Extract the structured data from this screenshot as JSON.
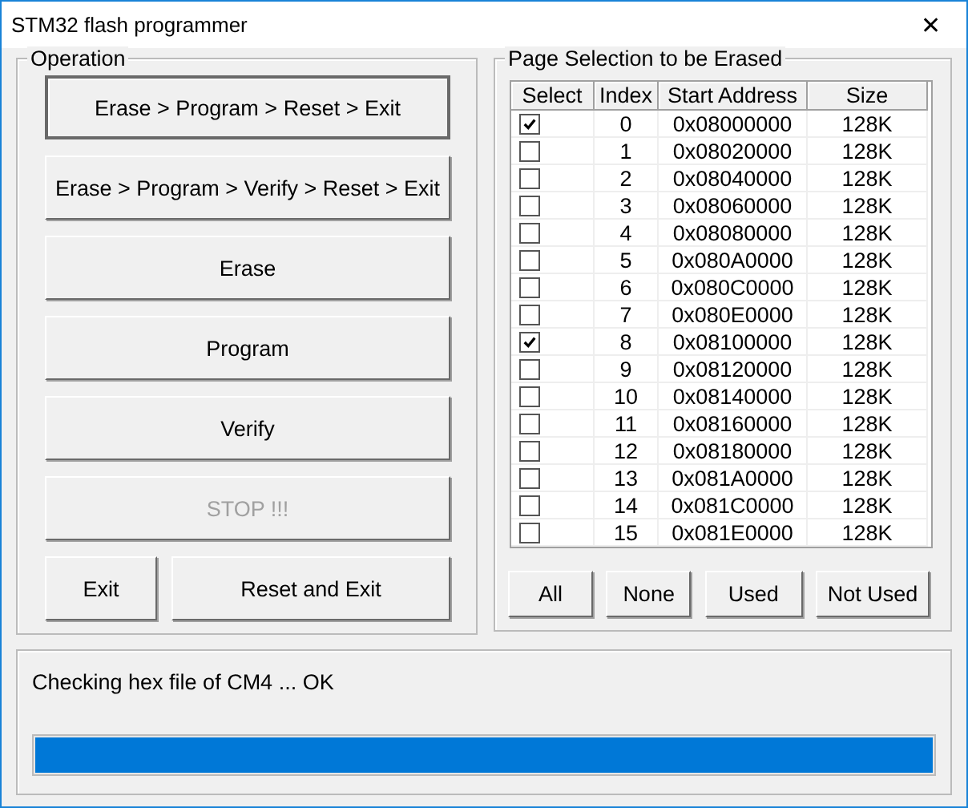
{
  "window": {
    "title": "STM32  flash programmer",
    "close": "✕"
  },
  "operation": {
    "title": "Operation",
    "buttons": [
      {
        "label": "Erase > Program > Reset > Exit",
        "disabled": false,
        "default": true
      },
      {
        "label": "Erase > Program > Verify > Reset > Exit",
        "disabled": false,
        "default": false
      },
      {
        "label": "Erase",
        "disabled": false,
        "default": false
      },
      {
        "label": "Program",
        "disabled": false,
        "default": false
      },
      {
        "label": "Verify",
        "disabled": false,
        "default": false
      },
      {
        "label": "STOP !!!",
        "disabled": true,
        "default": false
      }
    ],
    "bottom_buttons": [
      {
        "label": "Exit",
        "disabled": false,
        "default": false
      },
      {
        "label": "Reset and Exit",
        "disabled": false,
        "default": false
      }
    ]
  },
  "pages": {
    "title": "Page Selection to be Erased",
    "columns": [
      "Select",
      "Index",
      "Start Address",
      "Size"
    ],
    "rows": [
      {
        "checked": true,
        "index": "0",
        "address": "0x08000000",
        "size": "128K"
      },
      {
        "checked": false,
        "index": "1",
        "address": "0x08020000",
        "size": "128K"
      },
      {
        "checked": false,
        "index": "2",
        "address": "0x08040000",
        "size": "128K"
      },
      {
        "checked": false,
        "index": "3",
        "address": "0x08060000",
        "size": "128K"
      },
      {
        "checked": false,
        "index": "4",
        "address": "0x08080000",
        "size": "128K"
      },
      {
        "checked": false,
        "index": "5",
        "address": "0x080A0000",
        "size": "128K"
      },
      {
        "checked": false,
        "index": "6",
        "address": "0x080C0000",
        "size": "128K"
      },
      {
        "checked": false,
        "index": "7",
        "address": "0x080E0000",
        "size": "128K"
      },
      {
        "checked": true,
        "index": "8",
        "address": "0x08100000",
        "size": "128K"
      },
      {
        "checked": false,
        "index": "9",
        "address": "0x08120000",
        "size": "128K"
      },
      {
        "checked": false,
        "index": "10",
        "address": "0x08140000",
        "size": "128K"
      },
      {
        "checked": false,
        "index": "11",
        "address": "0x08160000",
        "size": "128K"
      },
      {
        "checked": false,
        "index": "12",
        "address": "0x08180000",
        "size": "128K"
      },
      {
        "checked": false,
        "index": "13",
        "address": "0x081A0000",
        "size": "128K"
      },
      {
        "checked": false,
        "index": "14",
        "address": "0x081C0000",
        "size": "128K"
      },
      {
        "checked": false,
        "index": "15",
        "address": "0x081E0000",
        "size": "128K"
      }
    ],
    "buttons": [
      "All",
      "None",
      "Used",
      "Not Used"
    ]
  },
  "status": {
    "message": "Checking hex file of CM4 ... OK",
    "progress": {
      "level": 1
    }
  }
}
